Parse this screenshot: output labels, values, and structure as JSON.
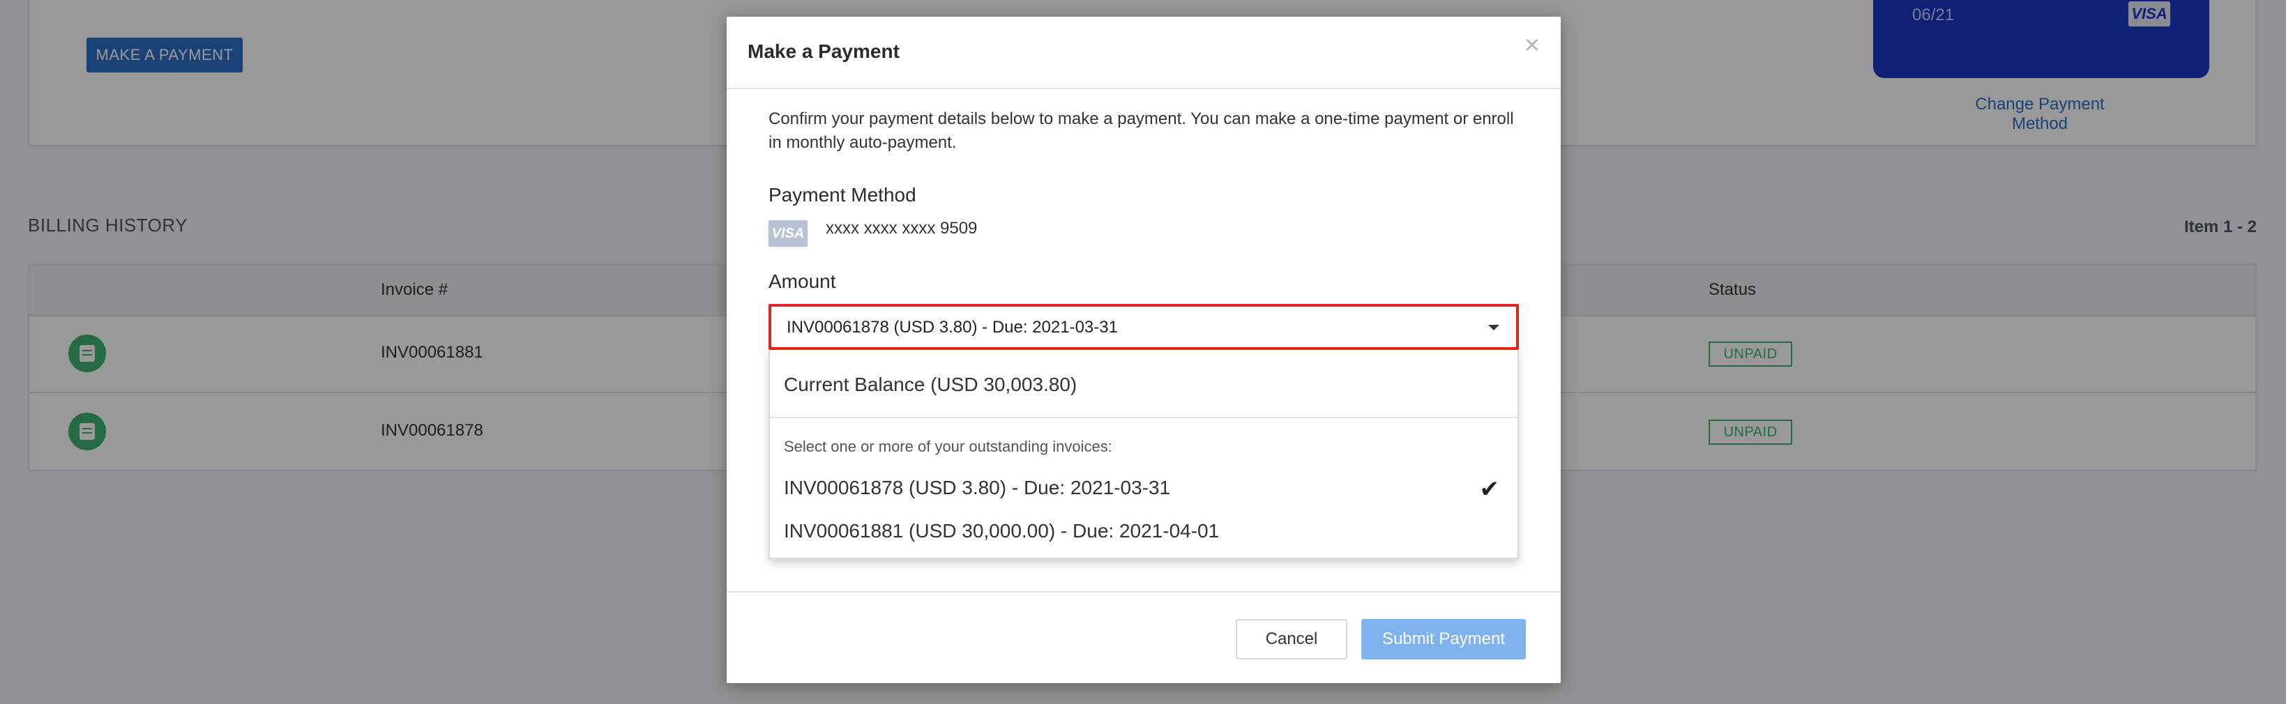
{
  "background": {
    "make_payment_button": "MAKE A PAYMENT",
    "card": {
      "expiry": "06/21",
      "brand": "VISA"
    },
    "change_payment_method": "Change Payment Method",
    "billing_history": {
      "title": "BILLING HISTORY",
      "item_range": "Item 1 - 2",
      "columns": {
        "invoice": "Invoice #",
        "status": "Status"
      },
      "rows": [
        {
          "invoice": "INV00061881",
          "status": "UNPAID"
        },
        {
          "invoice": "INV00061878",
          "status": "UNPAID"
        }
      ]
    }
  },
  "modal": {
    "title": "Make a Payment",
    "close": "×",
    "intro": "Confirm your payment details below to make a payment. You can make a one-time payment or enroll in monthly auto-payment.",
    "payment_method_label": "Payment Method",
    "card_brand": "VISA",
    "card_number": "xxxx xxxx xxxx 9509",
    "amount_label": "Amount",
    "amount_selected": "INV00061878 (USD 3.80) - Due: 2021-03-31",
    "dropdown": {
      "current_balance": "Current Balance (USD 30,003.80)",
      "hint": "Select one or more of your outstanding invoices:",
      "options": [
        {
          "label": "INV00061878 (USD 3.80) - Due: 2021-03-31",
          "selected": true
        },
        {
          "label": "INV00061881 (USD 30,000.00) - Due: 2021-04-01",
          "selected": false
        }
      ]
    },
    "check": "✔",
    "cancel": "Cancel",
    "submit": "Submit Payment"
  },
  "colors": {
    "primary": "#2c6fc6",
    "status_green": "#3cb371",
    "highlight_red": "#e0291d",
    "submit_disabled": "#7fb3ee"
  }
}
